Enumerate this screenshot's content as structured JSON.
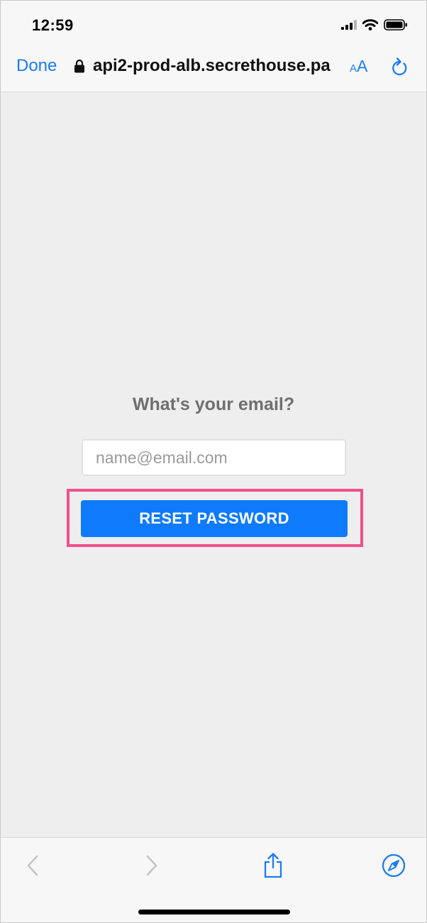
{
  "status_bar": {
    "time": "12:59",
    "icons": [
      "signal-icon",
      "wifi-icon",
      "battery-icon"
    ]
  },
  "browser": {
    "done_label": "Done",
    "url": "api2-prod-alb.secrethouse.pa",
    "text_size_small": "A",
    "text_size_big": "A",
    "icons": [
      "lock-icon",
      "text-size-icon",
      "reload-icon"
    ]
  },
  "form": {
    "heading": "What's your email?",
    "email_placeholder": "name@email.com",
    "email_value": "",
    "reset_label": "RESET PASSWORD"
  },
  "toolbar": {
    "icons": [
      "back-icon",
      "forward-icon",
      "share-icon",
      "compass-icon"
    ]
  },
  "colors": {
    "accent": "#0f7bfb",
    "highlight": "#f0508a",
    "heading_text": "#6f6f6f",
    "content_background": "#eeeeee"
  }
}
